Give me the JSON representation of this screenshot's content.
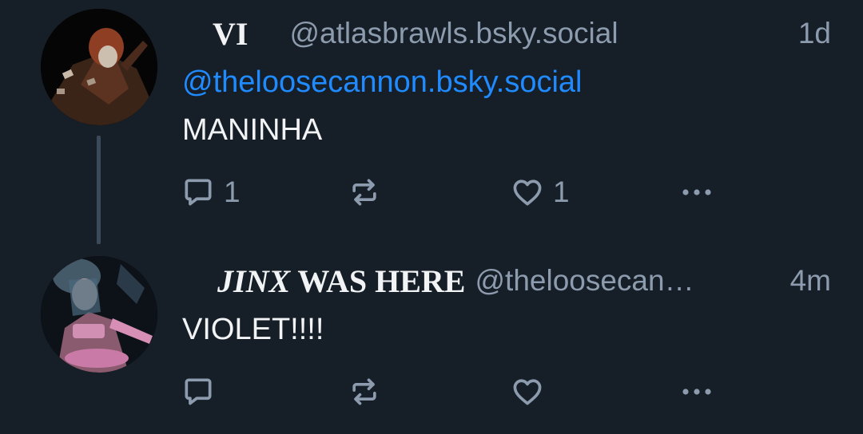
{
  "posts": [
    {
      "author": {
        "display_name": "VI",
        "handle": "@atlasbrawls.bsky.social",
        "avatar_colors": [
          "#2a1a12",
          "#7a3b22",
          "#c9b9a8"
        ]
      },
      "time": "1d",
      "mention": "@theloosecannon.bsky.social",
      "text": "MANINHA",
      "reply_count": "1",
      "like_count": "1"
    },
    {
      "author": {
        "display_name_italic": "JINX",
        "display_name_rest": " WAS HERE",
        "handle": "@theloosecan…",
        "avatar_colors": [
          "#1c2630",
          "#b27a9a",
          "#d9a4c4"
        ]
      },
      "time": "4m",
      "text": "VIOLET!!!!",
      "reply_count": "",
      "like_count": ""
    }
  ],
  "icons": {
    "reply": "reply-icon",
    "repost": "repost-icon",
    "like": "heart-icon",
    "more": "more-icon"
  },
  "colors": {
    "background": "#161e27",
    "text": "#f1f3f5",
    "muted": "#8c9bad",
    "link": "#208bfe",
    "thread_line": "#3b4a5b"
  }
}
